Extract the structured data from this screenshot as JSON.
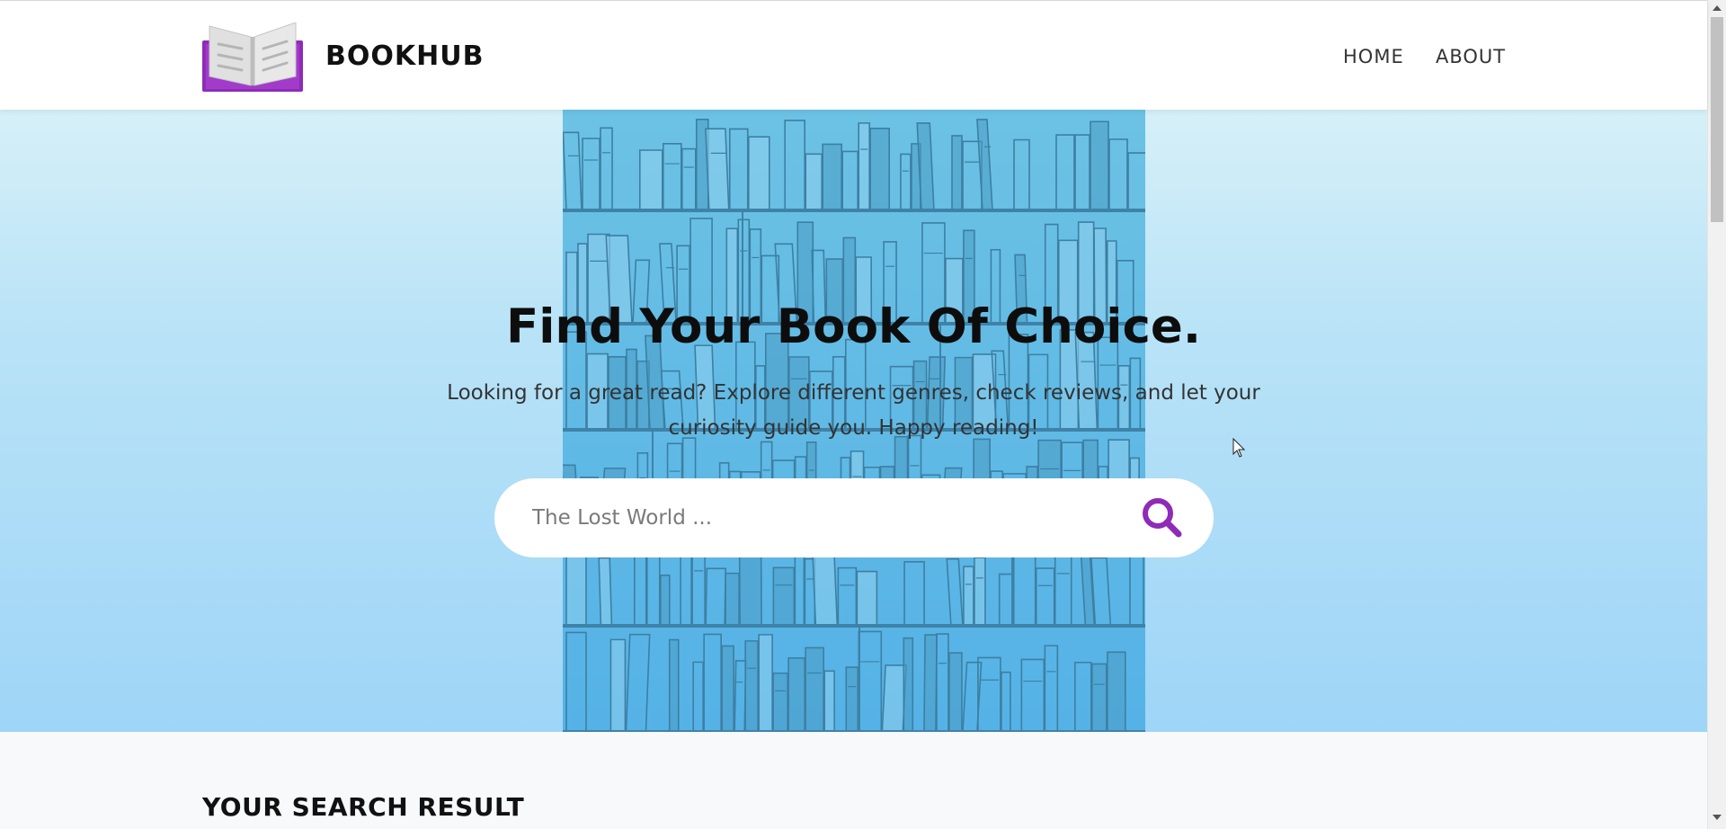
{
  "header": {
    "brand": "BOOKHUB",
    "logo_icon": "open-book-icon",
    "nav": {
      "home": "HOME",
      "about": "ABOUT"
    }
  },
  "hero": {
    "title": "Find Your Book Of Choice.",
    "subtitle": "Looking for a great read? Explore different genres, check reviews, and let your curiosity guide you. Happy reading!",
    "background_art": "bookshelf-illustration",
    "search": {
      "placeholder": "The Lost World ...",
      "value": "",
      "button_icon": "search-icon"
    }
  },
  "results": {
    "title": "YOUR SEARCH RESULT"
  },
  "colors": {
    "accent": "#8e2bb7",
    "hero_top": "#d6f0f8",
    "hero_bottom": "#9fd5f7",
    "shelf": "#5fb8e2"
  }
}
